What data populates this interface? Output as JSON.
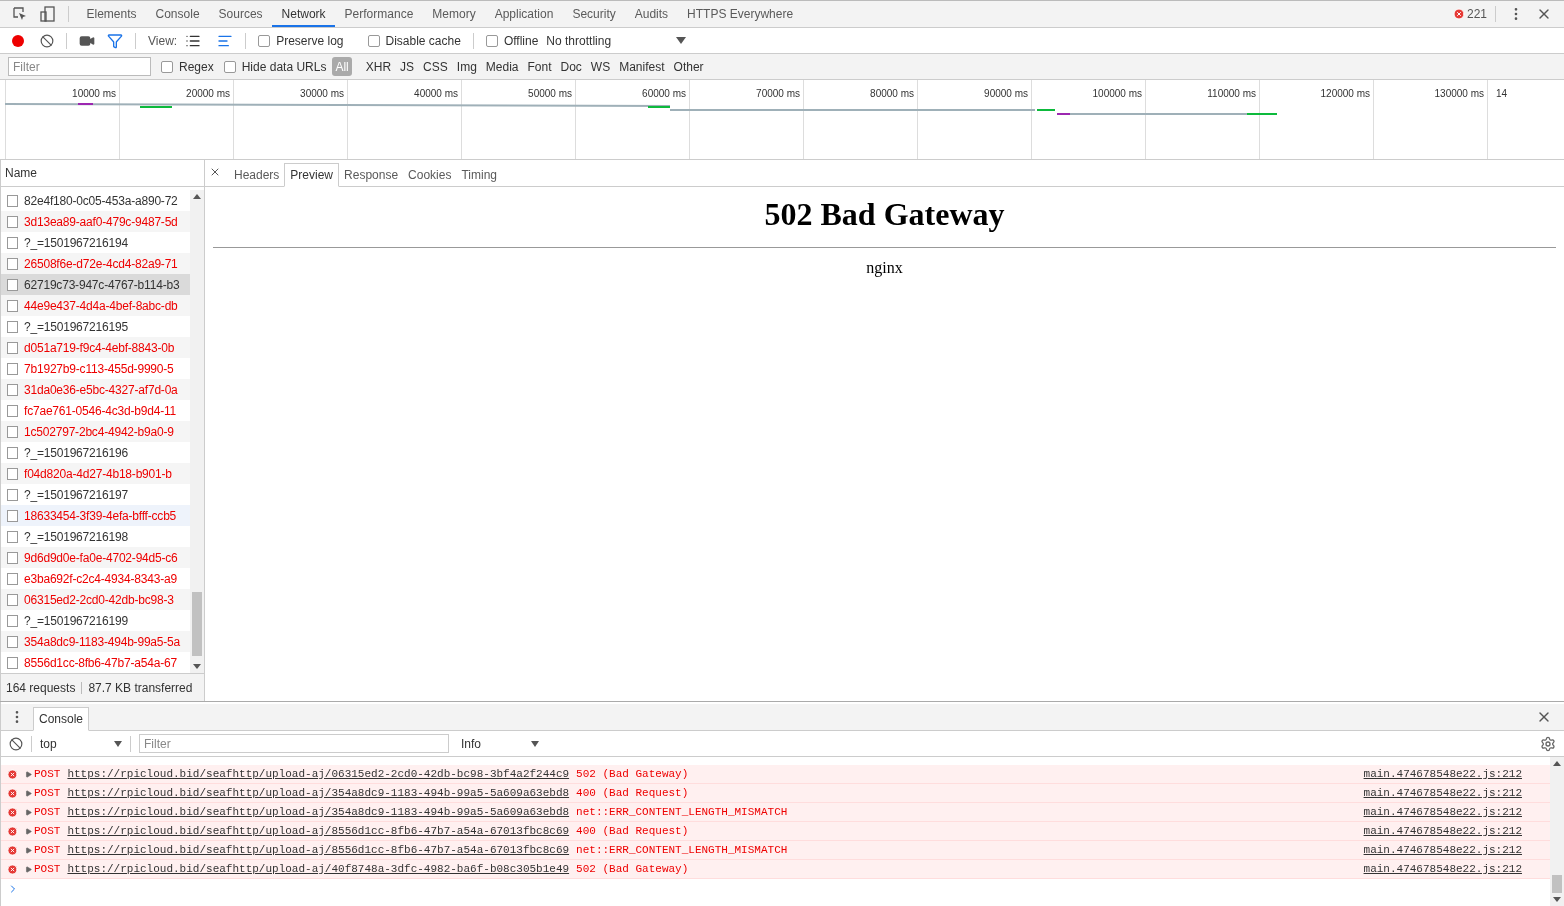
{
  "main_tabs": [
    {
      "label": "Elements",
      "selected": false
    },
    {
      "label": "Console",
      "selected": false
    },
    {
      "label": "Sources",
      "selected": false
    },
    {
      "label": "Network",
      "selected": true
    },
    {
      "label": "Performance",
      "selected": false
    },
    {
      "label": "Memory",
      "selected": false
    },
    {
      "label": "Application",
      "selected": false
    },
    {
      "label": "Security",
      "selected": false
    },
    {
      "label": "Audits",
      "selected": false
    },
    {
      "label": "HTTPS Everywhere",
      "selected": false
    }
  ],
  "error_count": "221",
  "toolbar": {
    "recording": true,
    "filter_active": true,
    "view_label": "View:",
    "waterfall_view": true,
    "checkboxes": [
      {
        "label": "Preserve log",
        "checked": false
      },
      {
        "label": "Disable cache",
        "checked": false
      },
      {
        "label": "Offline",
        "checked": false
      }
    ],
    "throttling": "No throttling"
  },
  "filter_bar": {
    "placeholder": "Filter",
    "checkboxes": [
      {
        "label": "Regex",
        "checked": false
      },
      {
        "label": "Hide data URLs",
        "checked": false
      }
    ],
    "types": [
      {
        "label": "All",
        "selected": true
      },
      {
        "label": "XHR",
        "selected": false
      },
      {
        "label": "JS",
        "selected": false
      },
      {
        "label": "CSS",
        "selected": false
      },
      {
        "label": "Img",
        "selected": false
      },
      {
        "label": "Media",
        "selected": false
      },
      {
        "label": "Font",
        "selected": false
      },
      {
        "label": "Doc",
        "selected": false
      },
      {
        "label": "WS",
        "selected": false
      },
      {
        "label": "Manifest",
        "selected": false
      },
      {
        "label": "Other",
        "selected": false
      }
    ]
  },
  "timeline": {
    "ticks": [
      "10000 ms",
      "20000 ms",
      "30000 ms",
      "40000 ms",
      "50000 ms",
      "60000 ms",
      "70000 ms",
      "80000 ms",
      "90000 ms",
      "100000 ms",
      "110000 ms",
      "120000 ms",
      "130000 ms",
      "14"
    ]
  },
  "requests": {
    "header": "Name",
    "rows": [
      {
        "name": "82e4f180-0c05-453a-a890-72",
        "failed": false,
        "selected": false,
        "hovered": false
      },
      {
        "name": "3d13ea89-aaf0-479c-9487-5d",
        "failed": true,
        "selected": false,
        "hovered": false
      },
      {
        "name": "?_=1501967216194",
        "failed": false,
        "selected": false,
        "hovered": false
      },
      {
        "name": "26508f6e-d72e-4cd4-82a9-71",
        "failed": true,
        "selected": false,
        "hovered": false
      },
      {
        "name": "62719c73-947c-4767-b114-b3",
        "failed": false,
        "selected": true,
        "hovered": false
      },
      {
        "name": "44e9e437-4d4a-4bef-8abc-db",
        "failed": true,
        "selected": false,
        "hovered": false
      },
      {
        "name": "?_=1501967216195",
        "failed": false,
        "selected": false,
        "hovered": false
      },
      {
        "name": "d051a719-f9c4-4ebf-8843-0b",
        "failed": true,
        "selected": false,
        "hovered": false
      },
      {
        "name": "7b1927b9-c113-455d-9990-5",
        "failed": true,
        "selected": false,
        "hovered": false
      },
      {
        "name": "31da0e36-e5bc-4327-af7d-0a",
        "failed": true,
        "selected": false,
        "hovered": false
      },
      {
        "name": "fc7ae761-0546-4c3d-b9d4-11",
        "failed": true,
        "selected": false,
        "hovered": false
      },
      {
        "name": "1c502797-2bc4-4942-b9a0-9",
        "failed": true,
        "selected": false,
        "hovered": false
      },
      {
        "name": "?_=1501967216196",
        "failed": false,
        "selected": false,
        "hovered": false
      },
      {
        "name": "f04d820a-4d27-4b18-b901-b",
        "failed": true,
        "selected": false,
        "hovered": false
      },
      {
        "name": "?_=1501967216197",
        "failed": false,
        "selected": false,
        "hovered": false
      },
      {
        "name": "18633454-3f39-4efa-bfff-ccb5",
        "failed": true,
        "selected": false,
        "hovered": true
      },
      {
        "name": "?_=1501967216198",
        "failed": false,
        "selected": false,
        "hovered": false
      },
      {
        "name": "9d6d9d0e-fa0e-4702-94d5-c6",
        "failed": true,
        "selected": false,
        "hovered": false
      },
      {
        "name": "e3ba692f-c2c4-4934-8343-a9",
        "failed": true,
        "selected": false,
        "hovered": false
      },
      {
        "name": "06315ed2-2cd0-42db-bc98-3",
        "failed": true,
        "selected": false,
        "hovered": false
      },
      {
        "name": "?_=1501967216199",
        "failed": false,
        "selected": false,
        "hovered": false
      },
      {
        "name": "354a8dc9-1183-494b-99a5-5a",
        "failed": true,
        "selected": false,
        "hovered": false
      },
      {
        "name": "8556d1cc-8fb6-47b7-a54a-67",
        "failed": true,
        "selected": false,
        "hovered": false
      }
    ],
    "summary": [
      "164 requests",
      "87.7 KB transferred"
    ]
  },
  "detail_tabs": [
    {
      "label": "Headers",
      "selected": false
    },
    {
      "label": "Preview",
      "selected": true
    },
    {
      "label": "Response",
      "selected": false
    },
    {
      "label": "Cookies",
      "selected": false
    },
    {
      "label": "Timing",
      "selected": false
    }
  ],
  "preview": {
    "heading": "502 Bad Gateway",
    "server": "nginx"
  },
  "drawer": {
    "tabs": [
      {
        "label": "Console",
        "selected": true
      }
    ],
    "context": "top",
    "filter_placeholder": "Filter",
    "level": "Info",
    "messages": [
      {
        "method": "POST",
        "url": "https://rpicloud.bid/seafhttp/upload-aj/06315ed2-2cd0-42db-bc98-3bf4a2f244c9",
        "status": "502 (Bad Gateway)",
        "source": "main.474678548e22.js:212"
      },
      {
        "method": "POST",
        "url": "https://rpicloud.bid/seafhttp/upload-aj/354a8dc9-1183-494b-99a5-5a609a63ebd8",
        "status": "400 (Bad Request)",
        "source": "main.474678548e22.js:212"
      },
      {
        "method": "POST",
        "url": "https://rpicloud.bid/seafhttp/upload-aj/354a8dc9-1183-494b-99a5-5a609a63ebd8",
        "status": "net::ERR_CONTENT_LENGTH_MISMATCH",
        "source": "main.474678548e22.js:212"
      },
      {
        "method": "POST",
        "url": "https://rpicloud.bid/seafhttp/upload-aj/8556d1cc-8fb6-47b7-a54a-67013fbc8c69",
        "status": "400 (Bad Request)",
        "source": "main.474678548e22.js:212"
      },
      {
        "method": "POST",
        "url": "https://rpicloud.bid/seafhttp/upload-aj/8556d1cc-8fb6-47b7-a54a-67013fbc8c69",
        "status": "net::ERR_CONTENT_LENGTH_MISMATCH",
        "source": "main.474678548e22.js:212"
      },
      {
        "method": "POST",
        "url": "https://rpicloud.bid/seafhttp/upload-aj/40f8748a-3dfc-4982-ba6f-b08c305b1e49",
        "status": "502 (Bad Gateway)",
        "source": "main.474678548e22.js:212"
      }
    ]
  }
}
